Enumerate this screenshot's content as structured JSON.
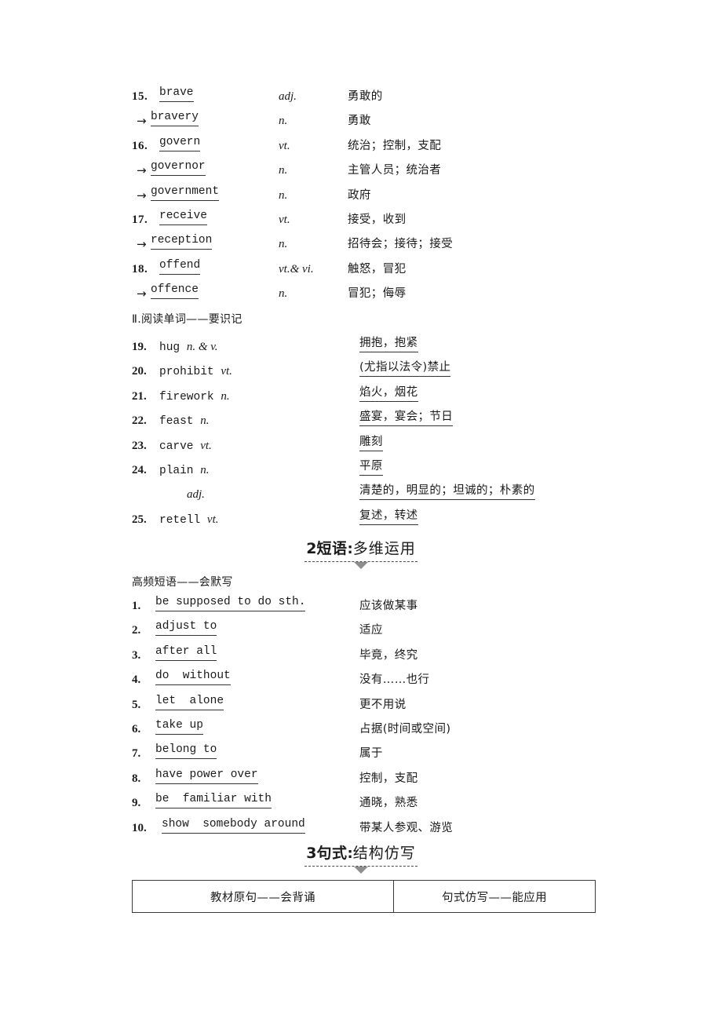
{
  "word_list": {
    "entries": [
      {
        "num": "15.",
        "arrow": false,
        "word": "brave",
        "pos": "adj.",
        "meaning": "勇敢的"
      },
      {
        "num": "",
        "arrow": true,
        "word": "bravery",
        "pos": "n.",
        "meaning": "勇敢"
      },
      {
        "num": "16.",
        "arrow": false,
        "word": "govern",
        "pos": "vt.",
        "meaning": "统治；控制，支配"
      },
      {
        "num": "",
        "arrow": true,
        "word": "governor",
        "pos": "n.",
        "meaning": "主管人员；统治者"
      },
      {
        "num": "",
        "arrow": true,
        "word": "government",
        "pos": "n.",
        "meaning": "政府"
      },
      {
        "num": "17.",
        "arrow": false,
        "word": "receive",
        "pos": "vt.",
        "meaning": "接受，收到"
      },
      {
        "num": "",
        "arrow": true,
        "word": "reception",
        "pos": "n.",
        "meaning": "招待会；接待；接受"
      },
      {
        "num": "18.",
        "arrow": false,
        "word": "offend",
        "pos": "vt.& vi.",
        "meaning": "触怒，冒犯"
      },
      {
        "num": "",
        "arrow": true,
        "word": "offence",
        "pos": "n.",
        "meaning": "冒犯；侮辱"
      }
    ]
  },
  "reading_words": {
    "heading": "Ⅱ.阅读单词——要识记",
    "entries": [
      {
        "num": "19.",
        "term": "hug",
        "pos": "n. & v.",
        "indent": false,
        "meaning": "拥抱，抱紧"
      },
      {
        "num": "20.",
        "term": "prohibit",
        "pos": "vt.",
        "indent": false,
        "meaning": "(尤指以法令)禁止"
      },
      {
        "num": "21.",
        "term": "firework",
        "pos": "n.",
        "indent": false,
        "meaning": "焰火，烟花"
      },
      {
        "num": "22.",
        "term": "feast",
        "pos": "n.",
        "indent": false,
        "meaning": "盛宴，宴会；节日"
      },
      {
        "num": "23.",
        "term": "carve",
        "pos": "vt.",
        "indent": false,
        "meaning": "雕刻"
      },
      {
        "num": "24.",
        "term": "plain",
        "pos": "n.",
        "indent": false,
        "meaning": "平原"
      },
      {
        "num": "",
        "term": "",
        "pos": "adj.",
        "indent": true,
        "meaning": "清楚的，明显的；坦诚的；朴素的"
      },
      {
        "num": "25.",
        "term": "retell",
        "pos": "vt.",
        "indent": false,
        "meaning": "复述，转述"
      }
    ]
  },
  "section_phrases": {
    "number": "2",
    "keyword": "短语",
    "colon": ":",
    "subtitle": "多维运用"
  },
  "phrases": {
    "heading": "高频短语——会默写",
    "entries": [
      {
        "num": "1.",
        "term": "be supposed to do sth.",
        "meaning": "应该做某事"
      },
      {
        "num": "2.",
        "term": "adjust to",
        "meaning": "适应"
      },
      {
        "num": "3.",
        "term": "after all",
        "meaning": "毕竟，终究"
      },
      {
        "num": "4.",
        "term": "do  without",
        "meaning": "没有……也行"
      },
      {
        "num": "5.",
        "term": "let  alone",
        "meaning": "更不用说"
      },
      {
        "num": "6.",
        "term": "take up",
        "meaning": "占据(时间或空间)"
      },
      {
        "num": "7.",
        "term": "belong to",
        "meaning": "属于"
      },
      {
        "num": "8.",
        "term": "have power over",
        "meaning": "控制，支配"
      },
      {
        "num": "9.",
        "term": "be  familiar with",
        "meaning": "通晓，熟悉"
      },
      {
        "num": "10.",
        "term": "show  somebody around",
        "meaning": "带某人参观、游览"
      }
    ]
  },
  "section_sentences": {
    "number": "3",
    "keyword": "句式",
    "colon": ":",
    "subtitle": "结构仿写"
  },
  "sentence_table": {
    "headers": [
      "教材原句——会背诵",
      "句式仿写——能应用"
    ]
  }
}
